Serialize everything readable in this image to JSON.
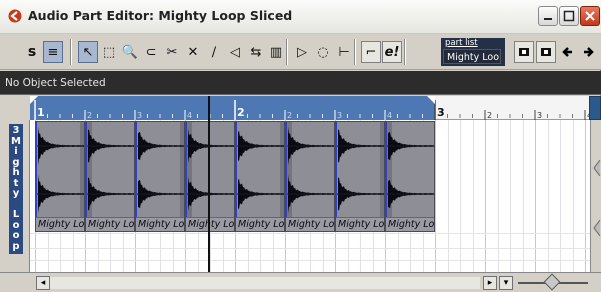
{
  "window": {
    "title": "Audio Part Editor: Mighty Loop Sliced",
    "accent": "#4d78b4"
  },
  "toolbar": {
    "tools": [
      {
        "name": "solo-button",
        "glyph": "s",
        "pressed": false
      },
      {
        "name": "autoscroll-button",
        "glyph": "≡",
        "pressed": true
      },
      {
        "name": "object-select-tool",
        "glyph": "↖",
        "pressed": true
      },
      {
        "name": "range-tool",
        "glyph": "⬚",
        "pressed": false
      },
      {
        "name": "zoom-tool",
        "glyph": "🔍",
        "pressed": false
      },
      {
        "name": "glue-tool",
        "glyph": "⊂",
        "pressed": false
      },
      {
        "name": "split-tool",
        "glyph": "✂",
        "pressed": false
      },
      {
        "name": "erase-tool",
        "glyph": "✕",
        "pressed": false
      },
      {
        "name": "draw-tool",
        "glyph": "∕",
        "pressed": false
      },
      {
        "name": "mute-tool",
        "glyph": "◁",
        "pressed": false
      },
      {
        "name": "timewarp-tool",
        "glyph": "⇆",
        "pressed": false
      },
      {
        "name": "scrub-tool",
        "glyph": "▥",
        "pressed": false
      },
      {
        "name": "play-tool",
        "glyph": "▷",
        "pressed": false
      },
      {
        "name": "loop-play-tool",
        "glyph": "◌",
        "pressed": false
      },
      {
        "name": "snap-button",
        "glyph": "⊢",
        "pressed": false
      },
      {
        "name": "edit-in-place-button",
        "glyph": "⌐",
        "pressed": false
      },
      {
        "name": "edit-active-part-button",
        "glyph": "e!",
        "pressed": false
      }
    ],
    "part_list_label": "part list",
    "part_list_value": "Mighty Loo"
  },
  "infoline": {
    "text": "No Object Selected"
  },
  "ruler": {
    "bar_labels": [
      "1",
      "2",
      "3",
      "4",
      "2",
      "2",
      "3",
      "4",
      "3",
      "2",
      "3",
      "4"
    ]
  },
  "track": {
    "letters": [
      "3",
      "M",
      "i",
      "g",
      "h",
      "t",
      "y",
      "",
      "L",
      "o",
      "o",
      "p"
    ]
  },
  "slices": [
    {
      "label": "Mighty Lo"
    },
    {
      "label": "Mighty Lo"
    },
    {
      "label": "Mighty Lo"
    },
    {
      "label": "Mighty Lo"
    },
    {
      "label": "Mighty Lo"
    },
    {
      "label": "Mighty Lo"
    },
    {
      "label": "Mighty Lo"
    },
    {
      "label": "Mighty Loo"
    }
  ]
}
